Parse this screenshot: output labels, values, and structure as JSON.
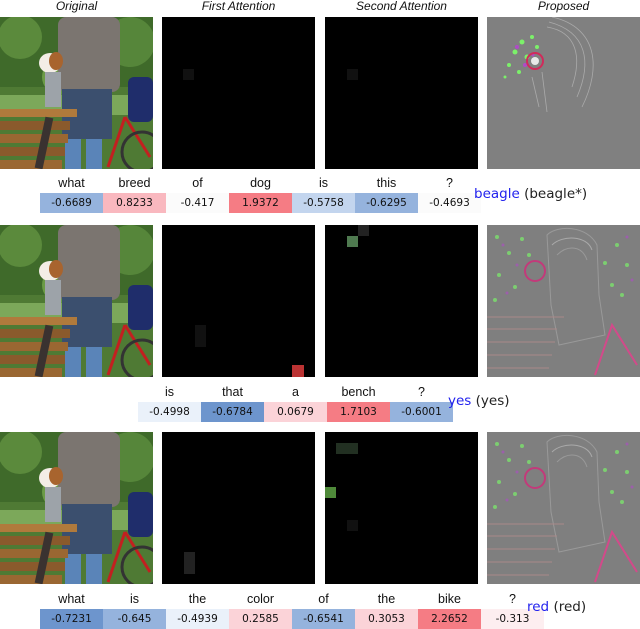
{
  "column_headers": [
    "Original",
    "First Attention",
    "Second Attention",
    "Proposed"
  ],
  "colors": {
    "strong_negative": "#6d95cd",
    "medium_negative": "#95b3dd",
    "light_negative": "#c3d5ee",
    "faint_negative": "#eaf1fa",
    "faint_positive": "#fdeef0",
    "light_positive": "#fbd3d8",
    "medium_positive": "#f9b8bf",
    "strong_positive": "#f57c84",
    "answer_prediction": "#2222ee"
  },
  "rows": [
    {
      "panels": {
        "original": "image-original-person-dog-bench-bike",
        "first_attention": "image-attention-dog-region",
        "second_attention": "image-attention-dog-region",
        "proposed": "image-proposed-saliency-dog"
      },
      "question": [
        {
          "word": "what",
          "value": "-0.6689",
          "tone": "medium_negative"
        },
        {
          "word": "breed",
          "value": "0.8233",
          "tone": "medium_positive"
        },
        {
          "word": "of",
          "value": "-0.417",
          "tone": "none"
        },
        {
          "word": "dog",
          "value": "1.9372",
          "tone": "strong_positive"
        },
        {
          "word": "is",
          "value": "-0.5758",
          "tone": "light_negative"
        },
        {
          "word": "this",
          "value": "-0.6295",
          "tone": "medium_negative"
        },
        {
          "word": "?",
          "value": "-0.4693",
          "tone": "none"
        }
      ],
      "answer": {
        "prediction": "beagle",
        "ground_truth": "(beagle*)"
      }
    },
    {
      "panels": {
        "original": "image-original-person-dog-bench-bike",
        "first_attention": "image-attention-bench-region",
        "second_attention": "image-attention-bench-scattered",
        "proposed": "image-proposed-saliency-scene"
      },
      "question": [
        {
          "word": "is",
          "value": "-0.4998",
          "tone": "faint_negative"
        },
        {
          "word": "that",
          "value": "-0.6784",
          "tone": "strong_negative"
        },
        {
          "word": "a",
          "value": "0.0679",
          "tone": "light_positive"
        },
        {
          "word": "bench",
          "value": "1.7103",
          "tone": "strong_positive"
        },
        {
          "word": "?",
          "value": "-0.6001",
          "tone": "medium_negative"
        }
      ],
      "answer": {
        "prediction": "yes",
        "ground_truth": "(yes)"
      }
    },
    {
      "panels": {
        "original": "image-original-person-dog-bench-bike",
        "first_attention": "image-attention-bike-region",
        "second_attention": "image-attention-scattered",
        "proposed": "image-proposed-saliency-scene"
      },
      "question": [
        {
          "word": "what",
          "value": "-0.7231",
          "tone": "strong_negative"
        },
        {
          "word": "is",
          "value": "-0.645",
          "tone": "medium_negative"
        },
        {
          "word": "the",
          "value": "-0.4939",
          "tone": "faint_negative"
        },
        {
          "word": "color",
          "value": "0.2585",
          "tone": "light_positive"
        },
        {
          "word": "of",
          "value": "-0.6541",
          "tone": "medium_negative"
        },
        {
          "word": "the",
          "value": "0.3053",
          "tone": "light_positive"
        },
        {
          "word": "bike",
          "value": "2.2652",
          "tone": "strong_positive"
        },
        {
          "word": "?",
          "value": "-0.313",
          "tone": "faint_positive"
        }
      ],
      "answer": {
        "prediction": "red",
        "ground_truth": "(red)"
      }
    }
  ]
}
